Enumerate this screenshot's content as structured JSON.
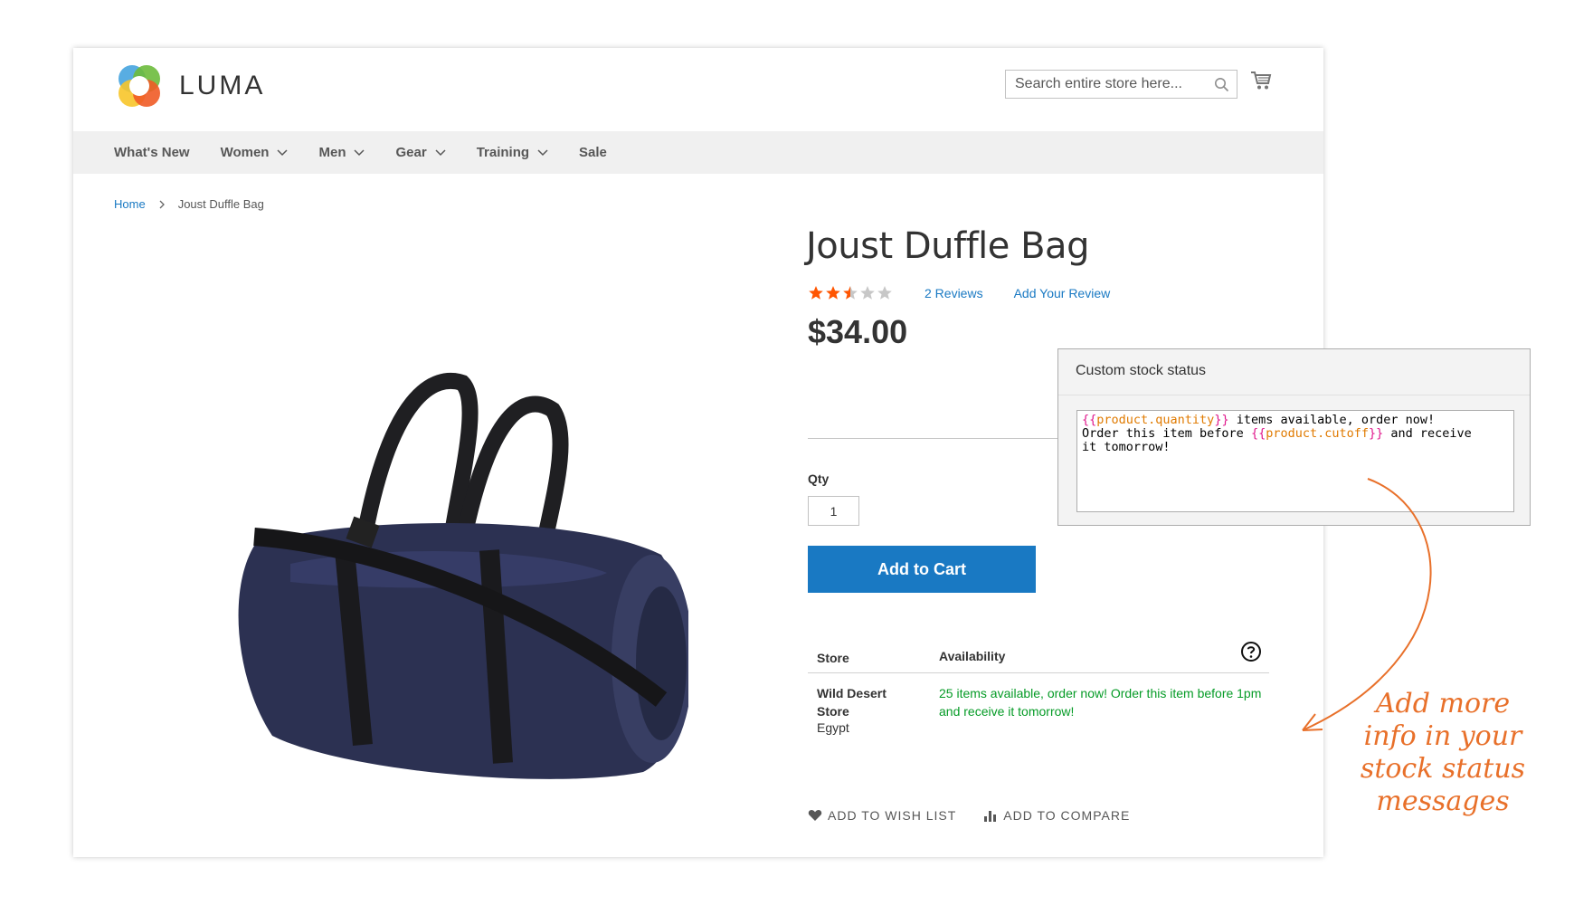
{
  "header": {
    "logo_text": "LUMA",
    "search_placeholder": "Search entire store here..."
  },
  "nav": {
    "items": [
      {
        "label": "What's New",
        "has_dropdown": false
      },
      {
        "label": "Women",
        "has_dropdown": true
      },
      {
        "label": "Men",
        "has_dropdown": true
      },
      {
        "label": "Gear",
        "has_dropdown": true
      },
      {
        "label": "Training",
        "has_dropdown": true
      },
      {
        "label": "Sale",
        "has_dropdown": false
      }
    ]
  },
  "breadcrumb": {
    "home": "Home",
    "current": "Joust Duffle Bag"
  },
  "product": {
    "title": "Joust Duffle Bag",
    "rating_stars": 2.5,
    "rating_max": 5,
    "reviews_link": "2  Reviews",
    "add_review_link": "Add Your Review",
    "price": "$34.00",
    "qty_label": "Qty",
    "qty_value": "1",
    "add_to_cart": "Add to Cart"
  },
  "availability": {
    "col_store": "Store",
    "col_availability": "Availability",
    "rows": [
      {
        "store": "Wild Desert Store",
        "country": "Egypt",
        "message": "25 items available, order now! Order this item before 1pm and receive it tomorrow!"
      }
    ]
  },
  "actions": {
    "wish_list": "ADD TO WISH LIST",
    "compare": "ADD TO COMPARE"
  },
  "panel": {
    "title": "Custom stock status",
    "line1_var": "product.quantity",
    "line1_text": " items available, order now!",
    "line2_text": "Order this item before ",
    "line2_var": "product.cutoff",
    "line2_tail": " and receive",
    "line3_text": "it tomorrow!",
    "open_brace": "{{",
    "close_brace": "}}"
  },
  "annotation": {
    "lines": [
      "Add more",
      "info in your",
      "stock status",
      "messages"
    ]
  },
  "colors": {
    "accent_blue": "#1979c3",
    "success_green": "#059b26",
    "star_orange": "#ff5501",
    "annotation_orange": "#e8702a"
  }
}
